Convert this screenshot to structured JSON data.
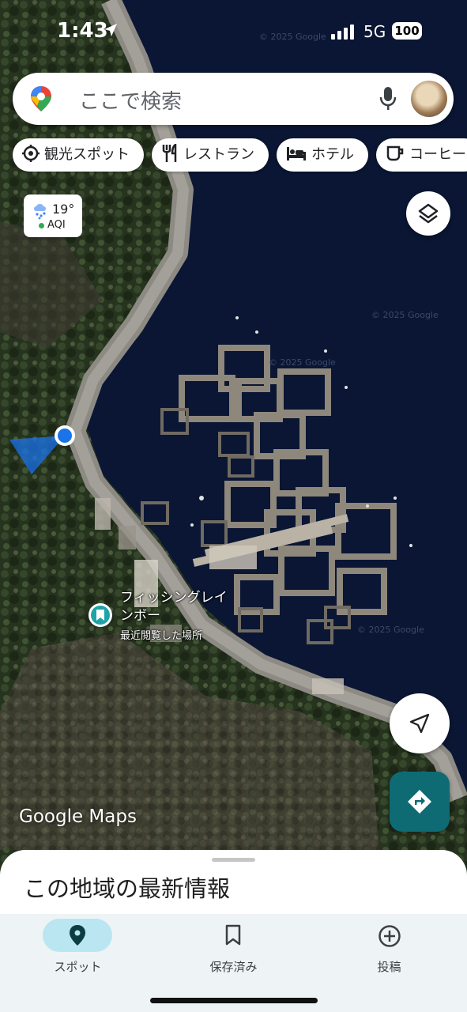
{
  "status_bar": {
    "time": "1:43",
    "network": "5G",
    "battery": "100"
  },
  "search": {
    "placeholder": "ここで検索"
  },
  "chips": [
    {
      "label": "観光スポット",
      "icon": "attraction-icon"
    },
    {
      "label": "レストラン",
      "icon": "restaurant-icon"
    },
    {
      "label": "ホテル",
      "icon": "hotel-icon"
    },
    {
      "label": "コーヒー",
      "icon": "coffee-icon"
    }
  ],
  "weather": {
    "temp": "19°",
    "aqi": "AQI"
  },
  "map": {
    "place_name_line1": "フィッシングレイ",
    "place_name_line2": "ンボー",
    "place_sub": "最近閲覧した場所",
    "watermark": "Google Maps",
    "copyright": "© 2025 Google"
  },
  "sheet": {
    "title": "この地域の最新情報"
  },
  "nav": [
    {
      "label": "スポット",
      "active": true
    },
    {
      "label": "保存済み",
      "active": false
    },
    {
      "label": "投稿",
      "active": false
    }
  ],
  "colors": {
    "accent": "#0e6b74",
    "active_pill": "#b9e6f1",
    "location_dot": "#1a73e8"
  }
}
